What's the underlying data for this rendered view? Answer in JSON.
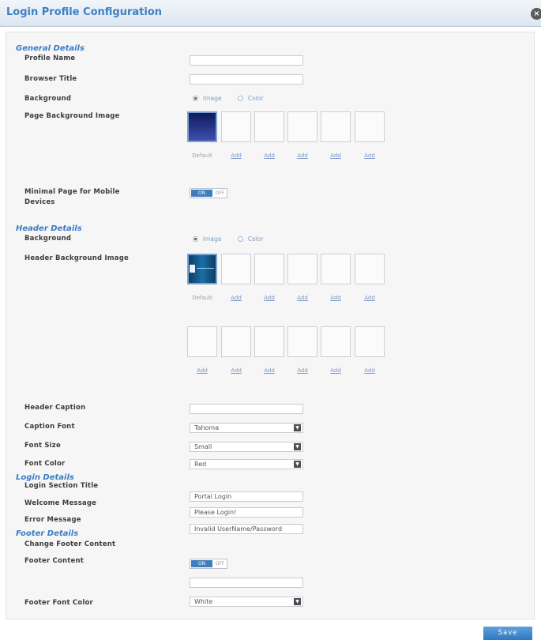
{
  "window": {
    "title": "Login Profile Configuration",
    "close_glyph": "×"
  },
  "general": {
    "heading": "General Details",
    "profile_name_label": "Profile Name",
    "profile_name_value": "",
    "browser_title_label": "Browser Title",
    "browser_title_value": "",
    "background_label": "Background",
    "background_options": [
      "Image",
      "Color"
    ],
    "background_selected": "Image",
    "page_bg_label": "Page Background Image",
    "thumb_default_label": "Default",
    "thumb_add_label": "Add",
    "minimal_label": "Minimal Page for Mobile Devices",
    "minimal_on": "ON",
    "minimal_off": "OFF"
  },
  "header": {
    "heading": "Header Details",
    "background_label": "Background",
    "background_options": [
      "Image",
      "Color"
    ],
    "background_selected": "Image",
    "header_bg_label": "Header Background Image",
    "thumb_default_label": "Default",
    "thumb_add_label": "Add",
    "caption_label": "Header Caption",
    "caption_value": "",
    "caption_font_label": "Caption Font",
    "caption_font_value": "Tahoma",
    "font_size_label": "Font Size",
    "font_size_value": "Small",
    "font_color_label": "Font Color",
    "font_color_value": "Red"
  },
  "login": {
    "heading": "Login Details",
    "section_title_label": "Login Section Title",
    "section_title_value": "Portal Login",
    "welcome_label": "Welcome Message",
    "welcome_value": "Please Login!",
    "error_label": "Error Message",
    "error_value": "Invalid UserName/Password"
  },
  "footer": {
    "heading": "Footer Details",
    "change_label": "Change Footer Content",
    "change_on": "ON",
    "change_off": "OFF",
    "content_label": "Footer Content",
    "content_value": "",
    "font_color_label": "Footer Font Color",
    "font_color_value": "White"
  },
  "actions": {
    "save_label": "Save"
  },
  "colors": {
    "accent": "#3b7cc4",
    "toggle_on": "#3e7dc0",
    "panel_bg": "#f6f6f6"
  },
  "icons": {
    "close": "close-icon",
    "dropdown": "chevron-down-icon"
  }
}
